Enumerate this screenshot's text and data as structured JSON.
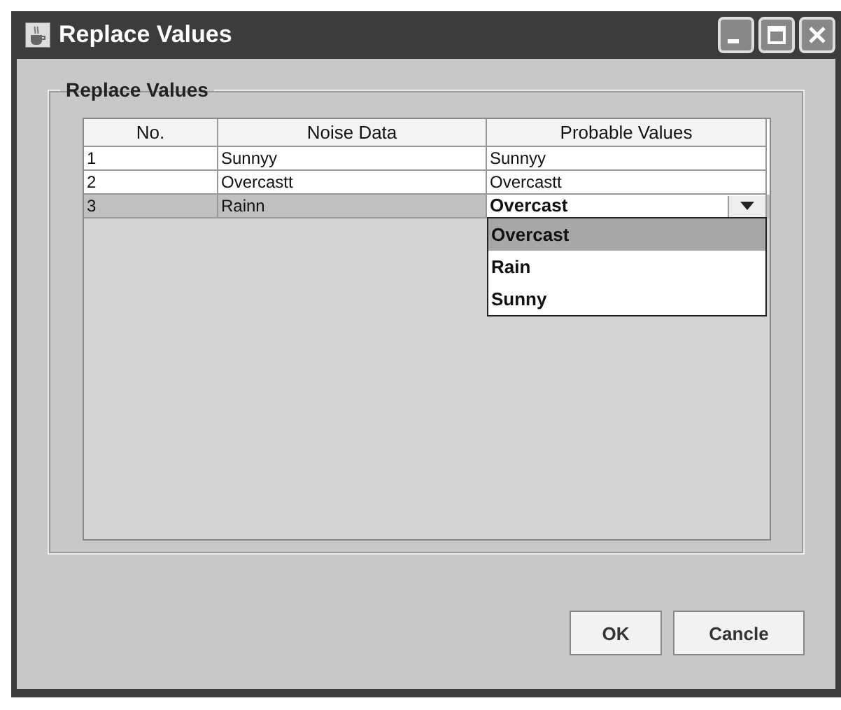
{
  "window": {
    "title": "Replace Values"
  },
  "group": {
    "title": "Replace Values"
  },
  "table": {
    "columns": [
      "No.",
      "Noise Data",
      "Probable Values"
    ],
    "rows": [
      {
        "no": "1",
        "noise": "Sunnyy",
        "probable": "Sunnyy",
        "kind": "text",
        "selected": false
      },
      {
        "no": "2",
        "noise": "Overcastt",
        "probable": "Overcastt",
        "kind": "text",
        "selected": false
      },
      {
        "no": "3",
        "noise": "Rainn",
        "probable": "Overcast",
        "kind": "combo",
        "selected": true,
        "expanded": true,
        "options": [
          {
            "label": "Overcast",
            "selected": true
          },
          {
            "label": "Rain",
            "selected": false
          },
          {
            "label": "Sunny",
            "selected": false
          }
        ]
      }
    ]
  },
  "buttons": [
    "OK",
    "Cancle"
  ]
}
